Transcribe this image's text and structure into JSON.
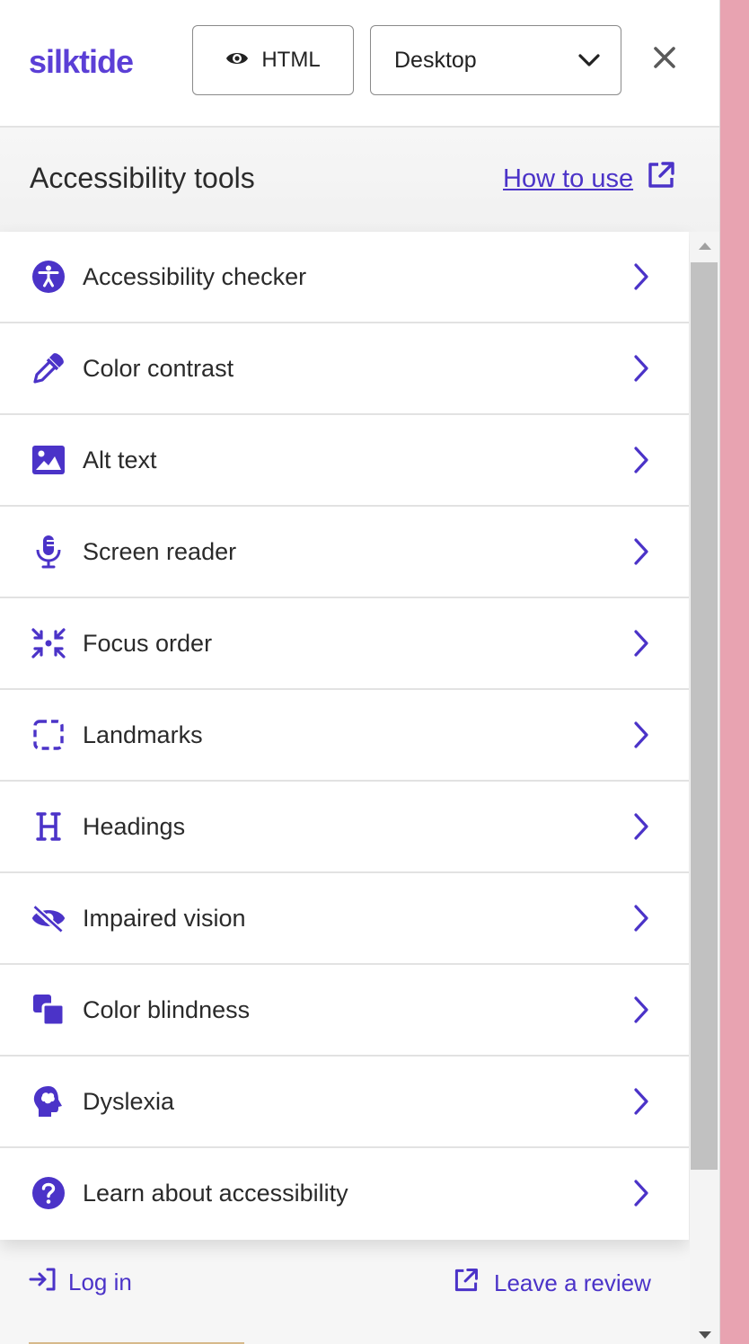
{
  "header": {
    "logo": "silktide",
    "html_button_label": "HTML",
    "device_select_value": "Desktop"
  },
  "section": {
    "title": "Accessibility tools",
    "how_to_label": "How to use"
  },
  "tools": [
    {
      "label": "Accessibility checker",
      "icon": "accessibility-icon"
    },
    {
      "label": "Color contrast",
      "icon": "eyedropper-icon"
    },
    {
      "label": "Alt text",
      "icon": "image-icon"
    },
    {
      "label": "Screen reader",
      "icon": "microphone-icon"
    },
    {
      "label": "Focus order",
      "icon": "focus-arrows-icon"
    },
    {
      "label": "Landmarks",
      "icon": "dashed-square-icon"
    },
    {
      "label": "Headings",
      "icon": "heading-icon"
    },
    {
      "label": "Impaired vision",
      "icon": "eye-slash-icon"
    },
    {
      "label": "Color blindness",
      "icon": "overlapping-squares-icon"
    },
    {
      "label": "Dyslexia",
      "icon": "brain-head-icon"
    },
    {
      "label": "Learn about accessibility",
      "icon": "question-icon"
    }
  ],
  "footer": {
    "login_label": "Log in",
    "review_label": "Leave a review"
  },
  "colors": {
    "accent": "#4b33c8",
    "logo": "#5b3fd6",
    "side_strip": "#e8a3b1"
  }
}
